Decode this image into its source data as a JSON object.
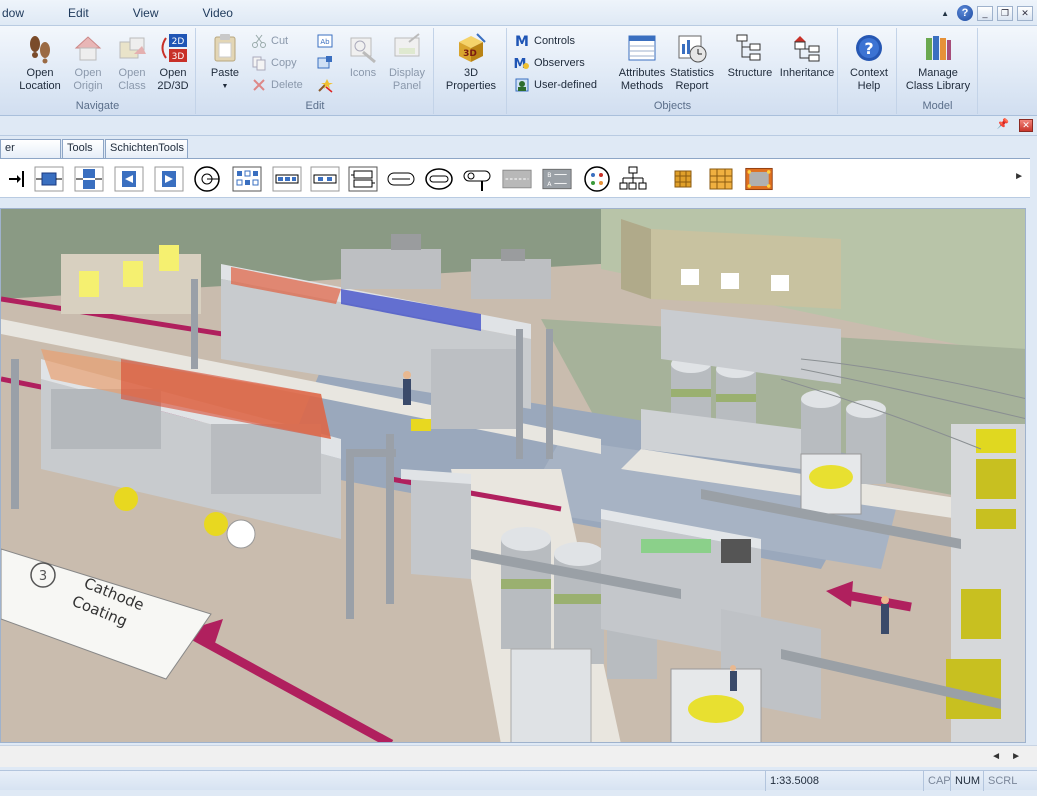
{
  "menu": {
    "items": [
      "dow",
      "Edit",
      "View",
      "Video"
    ]
  },
  "window_controls": {
    "help": "?",
    "minimize": "_",
    "restore": "❐",
    "close": "✕"
  },
  "ribbon": {
    "navigate": {
      "label": "Navigate",
      "open_location": "Open\nLocation",
      "open_origin": "Open\nOrigin",
      "open_class": "Open\nClass",
      "open_2d3d": "Open\n2D/3D"
    },
    "edit": {
      "label": "Edit",
      "paste": "Paste",
      "cut": "Cut",
      "copy": "Copy",
      "delete": "Delete",
      "icons": "Icons",
      "display_panel": "Display\nPanel"
    },
    "properties": {
      "label_3d": "3D\nProperties"
    },
    "objects": {
      "label": "Objects",
      "controls": "Controls",
      "observers": "Observers",
      "user_defined": "User-defined",
      "attributes_methods": "Attributes\nMethods",
      "statistics_report": "Statistics\nReport",
      "structure": "Structure",
      "inheritance": "Inheritance",
      "context_help": "Context\nHelp"
    },
    "model": {
      "label": "Model",
      "manage_class_library": "Manage\nClass Library"
    }
  },
  "tabs": [
    "er Interface",
    "Tools",
    "SchichtenTools"
  ],
  "scene": {
    "floor_label_number": "3",
    "floor_label_line1": "Cathode",
    "floor_label_line2": "Coating"
  },
  "status": {
    "time": "1:33.5008",
    "cap": "CAP",
    "num": "NUM",
    "scrl": "SCRL"
  }
}
